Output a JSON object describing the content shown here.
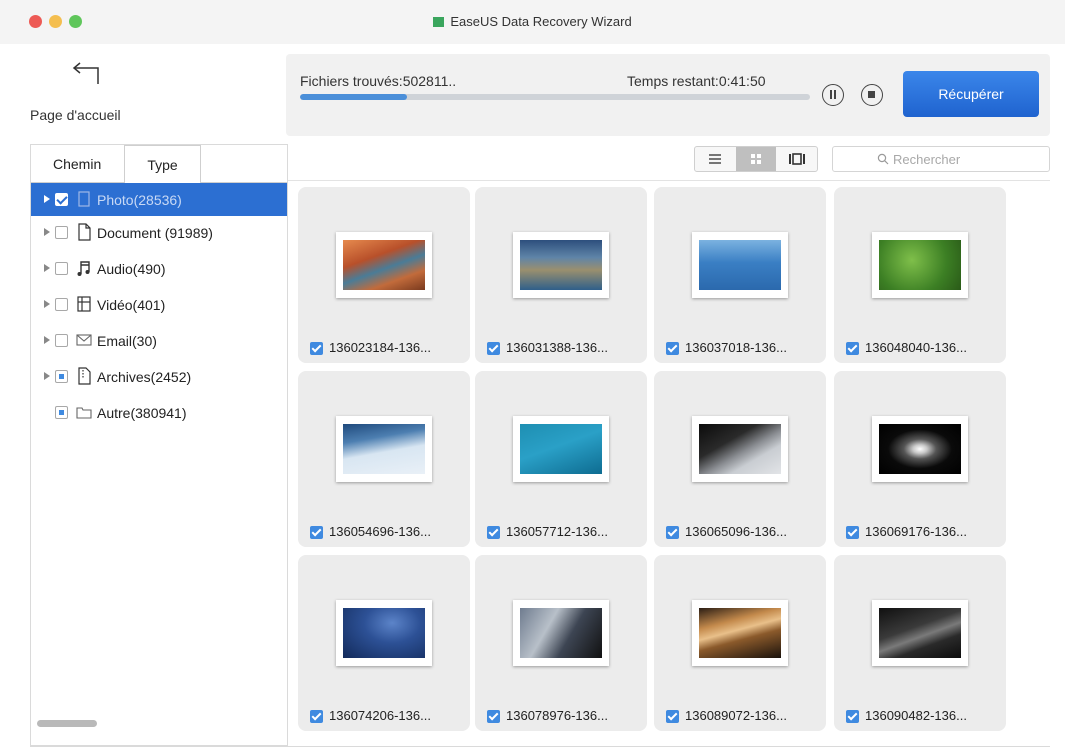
{
  "window": {
    "title": "EaseUS Data Recovery Wizard"
  },
  "header": {
    "home_label": "Page d'accueil",
    "files_found": "Fichiers trouvés:502811..",
    "time_remaining": "Temps restant:0:41:50",
    "progress_fraction": 0.21,
    "recover_label": "Récupérer"
  },
  "sidebar": {
    "tabs": [
      {
        "label": "Chemin"
      },
      {
        "label": "Type"
      }
    ],
    "items": [
      {
        "label": "Photo(28536)",
        "icon": "photo-icon",
        "checked": "checked",
        "selected": true,
        "expandable": true
      },
      {
        "label": "Document (91989)",
        "icon": "document-icon",
        "checked": "unchecked",
        "selected": false,
        "expandable": true
      },
      {
        "label": "Audio(490)",
        "icon": "music-icon",
        "checked": "unchecked",
        "selected": false,
        "expandable": true
      },
      {
        "label": "Vidéo(401)",
        "icon": "video-icon",
        "checked": "unchecked",
        "selected": false,
        "expandable": true
      },
      {
        "label": "Email(30)",
        "icon": "email-icon",
        "checked": "unchecked",
        "selected": false,
        "expandable": true
      },
      {
        "label": "Archives(2452)",
        "icon": "archive-icon",
        "checked": "partial",
        "selected": false,
        "expandable": true
      },
      {
        "label": "Autre(380941)",
        "icon": "folder-icon",
        "checked": "partial",
        "selected": false,
        "expandable": false
      }
    ]
  },
  "toolbar": {
    "view_modes": [
      "list-view-icon",
      "grid-view-icon",
      "filmstrip-view-icon"
    ],
    "active_view": "grid-view-icon",
    "search_placeholder": "Rechercher"
  },
  "files": [
    {
      "name": "136023184-136...",
      "checked": true
    },
    {
      "name": "136031388-136...",
      "checked": true
    },
    {
      "name": "136037018-136...",
      "checked": true
    },
    {
      "name": "136048040-136...",
      "checked": true
    },
    {
      "name": "136054696-136...",
      "checked": true
    },
    {
      "name": "136057712-136...",
      "checked": true
    },
    {
      "name": "136065096-136...",
      "checked": true
    },
    {
      "name": "136069176-136...",
      "checked": true
    },
    {
      "name": "136074206-136...",
      "checked": true
    },
    {
      "name": "136078976-136...",
      "checked": true
    },
    {
      "name": "136089072-136...",
      "checked": true
    },
    {
      "name": "136090482-136...",
      "checked": true
    }
  ],
  "colors": {
    "accent": "#2c6fd2",
    "recover_button": "#2a72dc",
    "progress": "#4b8fd9"
  }
}
